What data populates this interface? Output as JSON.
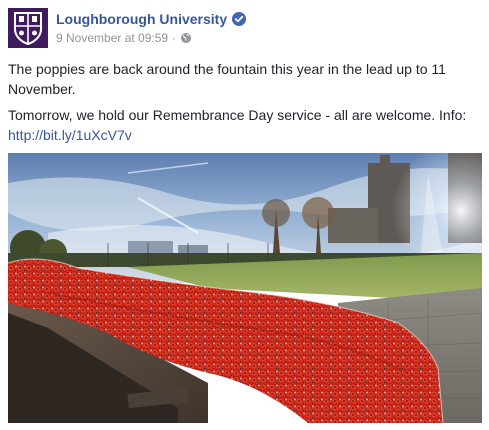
{
  "post": {
    "page_name": "Loughborough University",
    "timestamp": "9 November at 09:59",
    "separator": "·",
    "paragraph1": "The poppies are back around the fountain this year in the lead up to 11 November.",
    "paragraph2_text": "Tomorrow, we hold our Remembrance Day service - all are welcome. Info:",
    "link_text": "http://bit.ly/1uXcV7v"
  },
  "icons": {
    "avatar": "university-crest-icon",
    "verified": "verified-badge-icon",
    "privacy": "globe-icon"
  },
  "colors": {
    "link": "#365899",
    "text": "#1d2129",
    "muted": "#90949c",
    "crest_bg": "#3f1a5c",
    "verified": "#4267b2",
    "poppy_red": "#d6301e"
  }
}
